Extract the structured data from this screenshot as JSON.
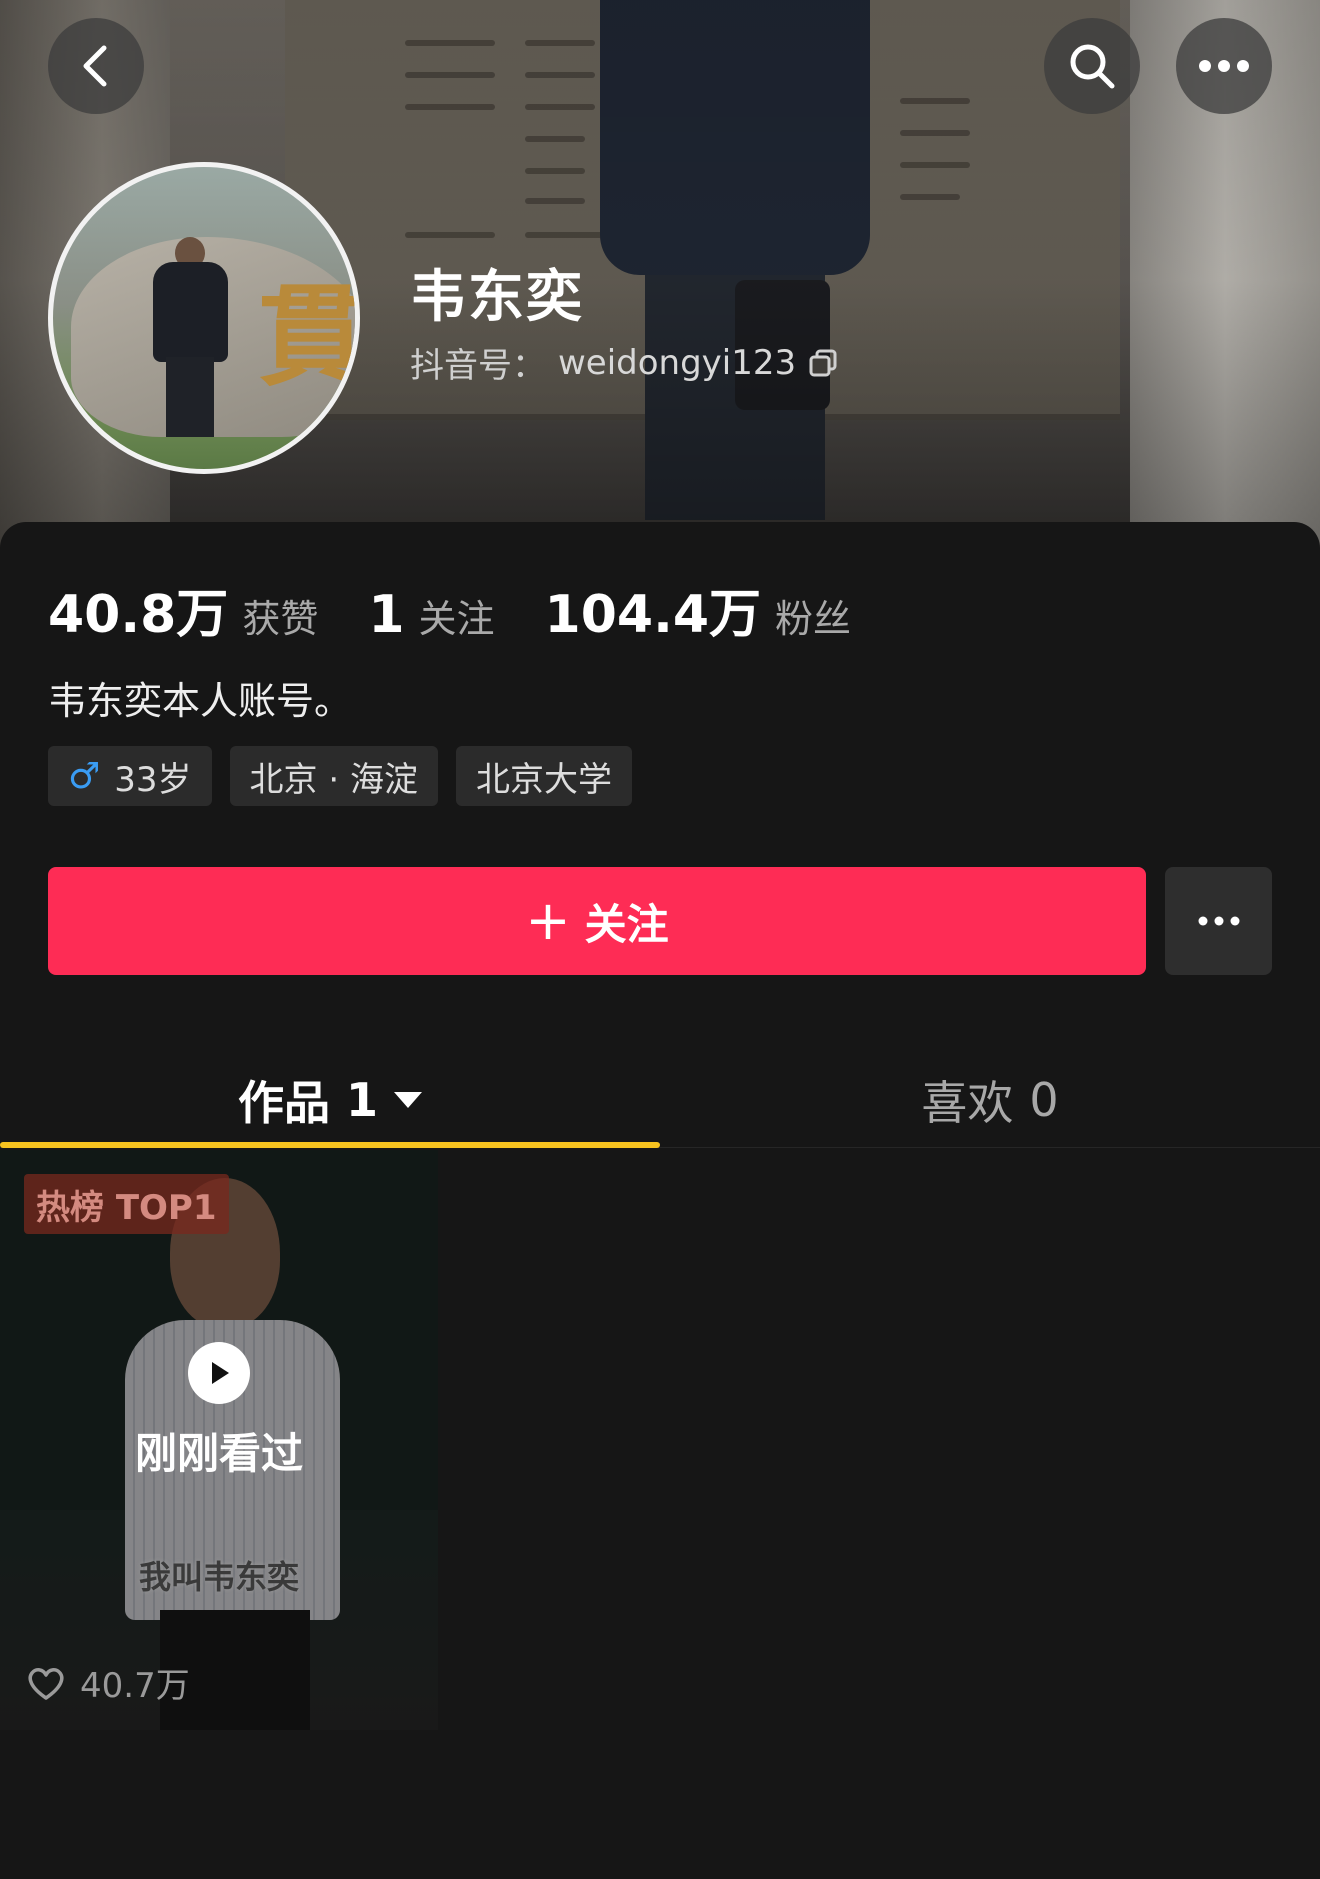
{
  "header": {
    "back_icon": "chevron-left-icon",
    "search_icon": "search-icon",
    "more_icon": "more-horizontal-icon"
  },
  "profile": {
    "name": "韦东奕",
    "id_prefix": "抖音号：",
    "id_value": "weidongyi123",
    "copy_icon": "copy-icon"
  },
  "stats": [
    {
      "value": "40.8万",
      "label": "获赞"
    },
    {
      "value": "1",
      "label": "关注"
    },
    {
      "value": "104.4万",
      "label": "粉丝"
    }
  ],
  "bio": "韦东奕本人账号。",
  "tags": {
    "gender_symbol": "♂",
    "age": "33岁",
    "location": "北京 · 海淀",
    "school": "北京大学"
  },
  "actions": {
    "follow_plus": "+",
    "follow_label": "关注",
    "more_icon": "more-horizontal-icon"
  },
  "tabs": [
    {
      "label": "作品",
      "count": "1",
      "active": true
    },
    {
      "label": "喜欢",
      "count": "0",
      "active": false
    }
  ],
  "videos": [
    {
      "badge": "热榜 TOP1",
      "recent_label": "刚刚看过",
      "caption": "我叫韦东奕",
      "likes": "40.7万"
    }
  ],
  "colors": {
    "follow_button": "#fe2c55",
    "tab_indicator": "#f7c21f",
    "gender_male": "#3a9cf3",
    "background": "#161616"
  }
}
